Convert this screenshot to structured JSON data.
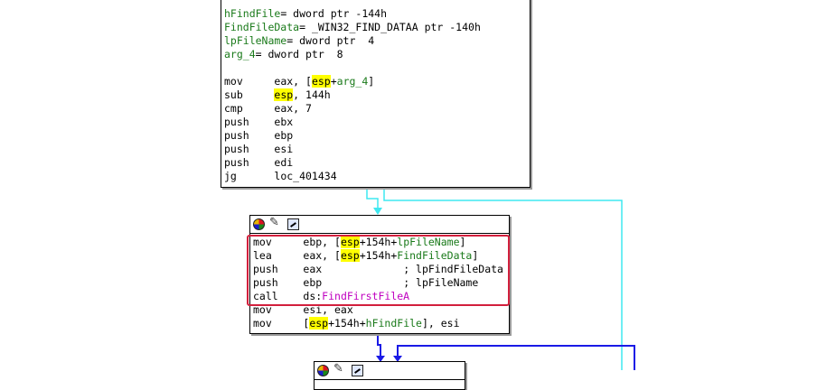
{
  "block1": {
    "vars": [
      {
        "name": "hFindFile",
        "rest": "= dword ptr -144h"
      },
      {
        "name": "FindFileData",
        "rest": "= _WIN32_FIND_DATAA ptr -140h"
      },
      {
        "name": "lpFileName",
        "rest": "= dword ptr  4"
      },
      {
        "name": "arg_4",
        "rest": "= dword ptr  8"
      }
    ],
    "instructions": [
      {
        "mn": "mov",
        "op_a": "eax, [",
        "hl": "esp",
        "op_b": "+arg_4]"
      },
      {
        "mn": "sub",
        "op_a": "",
        "hl": "esp",
        "op_b": ", 144h"
      },
      {
        "mn": "cmp",
        "op_a": "eax, 7",
        "hl": "",
        "op_b": ""
      },
      {
        "mn": "push",
        "op_a": "ebx",
        "hl": "",
        "op_b": ""
      },
      {
        "mn": "push",
        "op_a": "ebp",
        "hl": "",
        "op_b": ""
      },
      {
        "mn": "push",
        "op_a": "esi",
        "hl": "",
        "op_b": ""
      },
      {
        "mn": "push",
        "op_a": "edi",
        "hl": "",
        "op_b": ""
      },
      {
        "mn": "jg",
        "op_a": "loc_401434",
        "hl": "",
        "op_b": ""
      }
    ]
  },
  "block2": {
    "icons": [
      "colorful-globe-icon",
      "pencil-edit-icon",
      "graph-icon"
    ],
    "instructions": [
      {
        "mn": "mov",
        "pre": "ebp, [",
        "hl": "esp",
        "post": "+154h+lpFileName]",
        "comment": ""
      },
      {
        "mn": "lea",
        "pre": "eax, [",
        "hl": "esp",
        "post": "+154h+FindFileData]",
        "comment": ""
      },
      {
        "mn": "push",
        "pre": "eax",
        "hl": "",
        "post": "",
        "comment": "; lpFindFileData"
      },
      {
        "mn": "push",
        "pre": "ebp",
        "hl": "",
        "post": "",
        "comment": "; lpFileName"
      },
      {
        "mn": "call",
        "pre": "ds:",
        "hl": "",
        "post": "FindFirstFileA",
        "comment": ""
      },
      {
        "mn": "mov",
        "pre": "esi, eax",
        "hl": "",
        "post": "",
        "comment": ""
      },
      {
        "mn": "mov",
        "pre": "[",
        "hl": "esp",
        "post": "+154h+hFindFile], esi",
        "comment": ""
      }
    ]
  },
  "block3": {
    "icons": [
      "colorful-globe-icon",
      "pencil-edit-icon",
      "graph-icon"
    ]
  },
  "colors": {
    "highlight": "#ffff00",
    "edge_cyan": "#3fe8f0",
    "edge_blue": "#1a1ae6",
    "annotation_red": "#d21f3c",
    "name_green": "#1a7a1a",
    "import_pink": "#c000c0"
  }
}
